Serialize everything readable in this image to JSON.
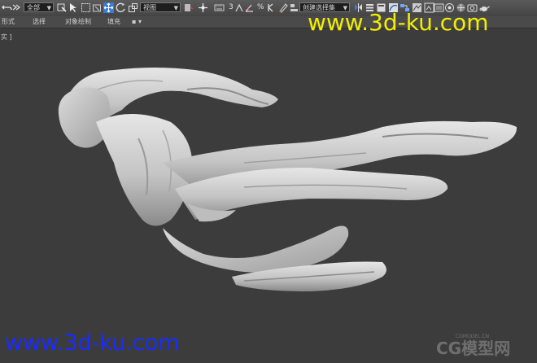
{
  "toolbar": {
    "selection_filter": "全部",
    "view_dropdown": "视图",
    "angle_snap_label": "3",
    "percent_snap_label": "%",
    "selection_set": "创建选择集",
    "icons": [
      "undo-icon",
      "redo-icon",
      "link-icon",
      "unlink-icon",
      "bind-space-warp-icon",
      "select-object-icon",
      "select-by-name-icon",
      "rectangle-region-icon",
      "window-crossing-icon",
      "move-icon",
      "rotate-icon",
      "scale-icon",
      "pivot-center-icon",
      "select-manipulate-icon",
      "keyboard-shortcut-icon",
      "snaps-icon",
      "angle-snap-icon",
      "percent-snap-icon",
      "spinner-snap-icon",
      "edit-named-selection-icon",
      "mirror-icon",
      "align-icon",
      "layer-manager-icon",
      "scene-explorer-icon",
      "curve-editor-icon",
      "schematic-view-icon",
      "material-editor-icon",
      "render-setup-icon",
      "rendered-frame-icon",
      "render-icon",
      "teapot-icon"
    ]
  },
  "ribbon": {
    "tabs": [
      "形式",
      "选择",
      "对象绘制",
      "填充",
      "▪ ▾"
    ]
  },
  "viewport": {
    "label": "实 ]"
  },
  "watermarks": {
    "top": "www.3d-ku.com",
    "bottom": "www.3d-ku.com",
    "corner_brand": "CG模型网",
    "corner_url": "CGMODEL.CN"
  },
  "colors": {
    "toolbar_bg": "#4f4f4f",
    "viewport_bg": "#3c3c3c",
    "watermark_yellow": "#f2ee00",
    "watermark_blue": "#1a2cff",
    "model": "#cdcdcd"
  }
}
